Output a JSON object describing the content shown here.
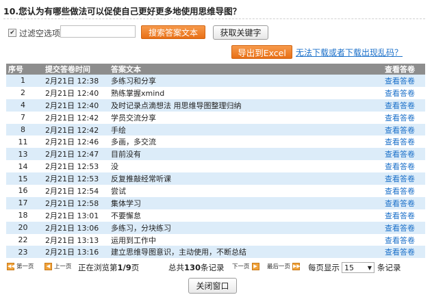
{
  "question": "10.您认为有哪些做法可以促使自己更好更多地使用思维导图？",
  "filter": {
    "checked": true,
    "checkbox_label": "过滤空选项",
    "input_value": "",
    "search_button": "搜索答案文本",
    "keyword_button": "获取关键字"
  },
  "export": {
    "excel_button": "导出到Excel",
    "garbled_link": "无法下载或者下载出现乱码？"
  },
  "table": {
    "headers": {
      "no": "序号",
      "time": "提交答卷时间",
      "text": "答案文本",
      "view": "查看答卷"
    },
    "rows": [
      {
        "no": "1",
        "time": "2月21日 12:38",
        "text": "多练习和分享",
        "view": "查看答卷"
      },
      {
        "no": "2",
        "time": "2月21日 12:40",
        "text": "熟练掌握xmind",
        "view": "查看答卷"
      },
      {
        "no": "4",
        "time": "2月21日 12:40",
        "text": "及时记录点滴想法 用思维导图整理归纳",
        "view": "查看答卷"
      },
      {
        "no": "7",
        "time": "2月21日 12:42",
        "text": "学员交流分享",
        "view": "查看答卷"
      },
      {
        "no": "8",
        "time": "2月21日 12:42",
        "text": "手绘",
        "view": "查看答卷"
      },
      {
        "no": "11",
        "time": "2月21日 12:46",
        "text": "多画，多交流",
        "view": "查看答卷"
      },
      {
        "no": "13",
        "time": "2月21日 12:47",
        "text": "目前没有",
        "view": "查看答卷"
      },
      {
        "no": "14",
        "time": "2月21日 12:53",
        "text": "没",
        "view": "查看答卷"
      },
      {
        "no": "15",
        "time": "2月21日 12:53",
        "text": "反复推敲经常听课",
        "view": "查看答卷"
      },
      {
        "no": "16",
        "time": "2月21日 12:54",
        "text": "尝试",
        "view": "查看答卷"
      },
      {
        "no": "17",
        "time": "2月21日 12:58",
        "text": "集体学习",
        "view": "查看答卷"
      },
      {
        "no": "18",
        "time": "2月21日 13:01",
        "text": "不要懈怠",
        "view": "查看答卷"
      },
      {
        "no": "20",
        "time": "2月21日 13:06",
        "text": "多练习，分块练习",
        "view": "查看答卷"
      },
      {
        "no": "22",
        "time": "2月21日 13:13",
        "text": "运用到工作中",
        "view": "查看答卷"
      },
      {
        "no": "23",
        "time": "2月21日 13:16",
        "text": "建立思维导图意识，主动使用，不断总结",
        "view": "查看答卷"
      }
    ]
  },
  "pager": {
    "first": "第一页",
    "prev": "上一页",
    "browsing_prefix": "正在浏览第",
    "page": "1/9",
    "browsing_suffix": "页",
    "total_prefix": "总共",
    "total": "130",
    "total_suffix": "条记录",
    "next": "下一页",
    "last": "最后一页",
    "per_page_prefix": "每页显示",
    "per_page": "15",
    "per_page_suffix": "条记录"
  },
  "close_button": "关闭窗口",
  "colors": {
    "accent_orange": "#e86f16",
    "header_gray": "#8d8d8d",
    "row_blue": "#dcecf9",
    "link_blue": "#1a6fc9"
  },
  "icons": {
    "checkbox": "check-icon",
    "dropdown": "triangle-down-icon",
    "first": "double-left-arrow-icon",
    "prev": "left-arrow-icon",
    "next": "right-arrow-icon",
    "last": "double-right-arrow-icon"
  }
}
